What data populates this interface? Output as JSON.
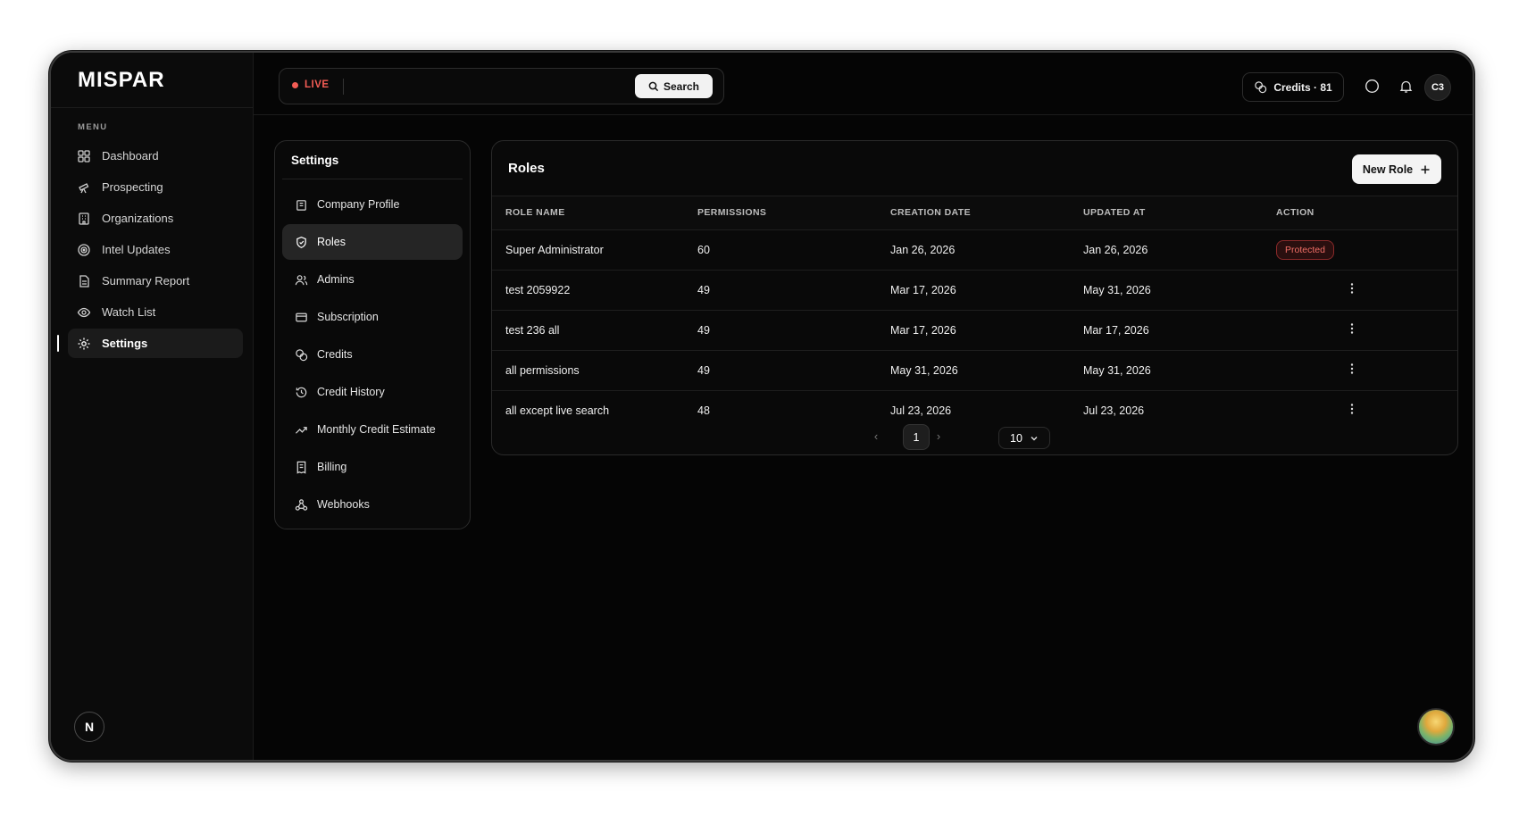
{
  "brand": "MISPAR",
  "menu_label": "MENU",
  "sidebar": {
    "items": [
      {
        "label": "Dashboard",
        "icon": "dashboard-icon"
      },
      {
        "label": "Prospecting",
        "icon": "telescope-icon"
      },
      {
        "label": "Organizations",
        "icon": "building-icon"
      },
      {
        "label": "Intel Updates",
        "icon": "radar-icon"
      },
      {
        "label": "Summary Report",
        "icon": "document-icon"
      },
      {
        "label": "Watch List",
        "icon": "eye-icon"
      },
      {
        "label": "Settings",
        "icon": "gear-icon",
        "active": true
      }
    ],
    "user_initial": "N"
  },
  "topbar": {
    "live_label": "LIVE",
    "search_label": "Search",
    "credits_label": "Credits · 81",
    "avatar_initials": "C3"
  },
  "settings_panel": {
    "title": "Settings",
    "items": [
      {
        "label": "Company Profile",
        "icon": "building-icon"
      },
      {
        "label": "Roles",
        "icon": "shield-icon",
        "active": true
      },
      {
        "label": "Admins",
        "icon": "users-icon"
      },
      {
        "label": "Subscription",
        "icon": "card-icon"
      },
      {
        "label": "Credits",
        "icon": "coins-icon"
      },
      {
        "label": "Credit History",
        "icon": "history-icon"
      },
      {
        "label": "Monthly Credit Estimate",
        "icon": "trend-icon"
      },
      {
        "label": "Billing",
        "icon": "receipt-icon"
      },
      {
        "label": "Webhooks",
        "icon": "webhook-icon"
      }
    ]
  },
  "roles": {
    "title": "Roles",
    "new_button": "New Role",
    "columns": [
      "ROLE NAME",
      "PERMISSIONS",
      "CREATION DATE",
      "UPDATED AT",
      "ACTION"
    ],
    "rows": [
      {
        "name": "Super Administrator",
        "permissions": "60",
        "created": "Jan 26, 2026",
        "updated": "Jan 26, 2026",
        "action": "Protected"
      },
      {
        "name": "test 2059922",
        "permissions": "49",
        "created": "Mar 17, 2026",
        "updated": "May 31, 2026",
        "action": "menu"
      },
      {
        "name": "test 236 all",
        "permissions": "49",
        "created": "Mar 17, 2026",
        "updated": "Mar 17, 2026",
        "action": "menu"
      },
      {
        "name": "all permissions",
        "permissions": "49",
        "created": "May 31, 2026",
        "updated": "May 31, 2026",
        "action": "menu"
      },
      {
        "name": "all except live search",
        "permissions": "48",
        "created": "Jul 23, 2026",
        "updated": "Jul 23, 2026",
        "action": "menu"
      }
    ],
    "pagination": {
      "current_page": "1",
      "page_size": "10"
    }
  },
  "colors": {
    "background": "#050505",
    "live_red": "#f25c54",
    "protected_badge": "#f06e66"
  }
}
